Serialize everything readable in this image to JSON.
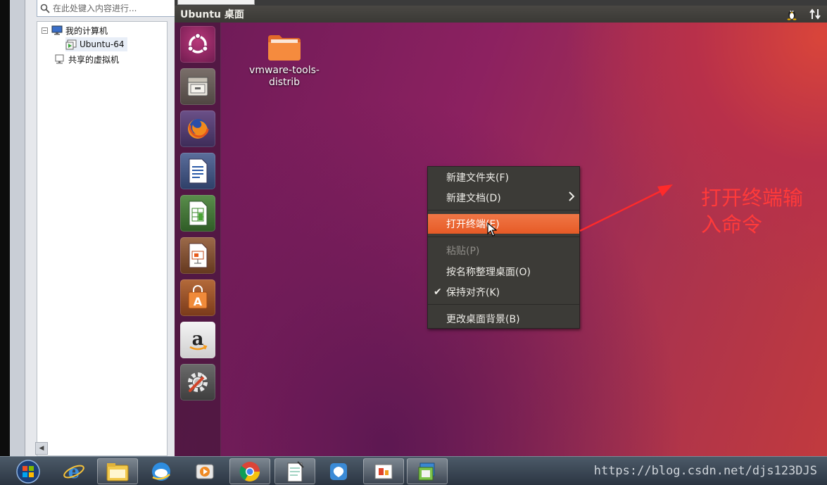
{
  "library": {
    "search_placeholder": "在此处键入内容进行...",
    "tree": [
      {
        "label": "我的计算机",
        "expander": "−"
      },
      {
        "label": "Ubuntu-64"
      },
      {
        "label": "共享的虚拟机"
      }
    ]
  },
  "vm": {
    "title": "Ubuntu 桌面",
    "indicators": [
      "penguin-icon",
      "network-updown-icon"
    ],
    "launcher": [
      "ubuntu-dash-icon",
      "file-manager-icon",
      "firefox-icon",
      "writer-icon",
      "calc-icon",
      "impress-icon",
      "software-center-icon",
      "amazon-icon",
      "system-settings-icon"
    ],
    "desktop_icon": {
      "label": "vmware-tools-\ndistrib",
      "icon": "folder-icon"
    }
  },
  "context_menu": {
    "items": [
      {
        "label": "新建文件夹(F)"
      },
      {
        "label": "新建文档(D)",
        "submenu": true
      },
      {
        "label": "打开终端(E)",
        "highlighted": true
      },
      {
        "label": "粘贴(P)",
        "disabled": true
      },
      {
        "label": "按名称整理桌面(O)"
      },
      {
        "label": "保持对齐(K)",
        "checked": true
      },
      {
        "label": "更改桌面背景(B)"
      }
    ]
  },
  "annotation": {
    "text": "打开终端输入命令",
    "line1": "打开终端输",
    "line2": "入命令",
    "color": "#ff3a3a"
  },
  "taskbar": {
    "items": [
      "start-orb-icon",
      "ie-icon",
      "explorer-icon",
      "qq-browser-icon",
      "media-player-icon",
      "chrome-icon",
      "notepad-icon",
      "app-icon",
      "slides-icon",
      "vmware-icon"
    ],
    "watermark": "https://blog.csdn.net/djs123DJS"
  },
  "colors": {
    "menu_highlight": "#e95420",
    "menu_bg": "#3c3b37",
    "launcher": "#46183c"
  }
}
